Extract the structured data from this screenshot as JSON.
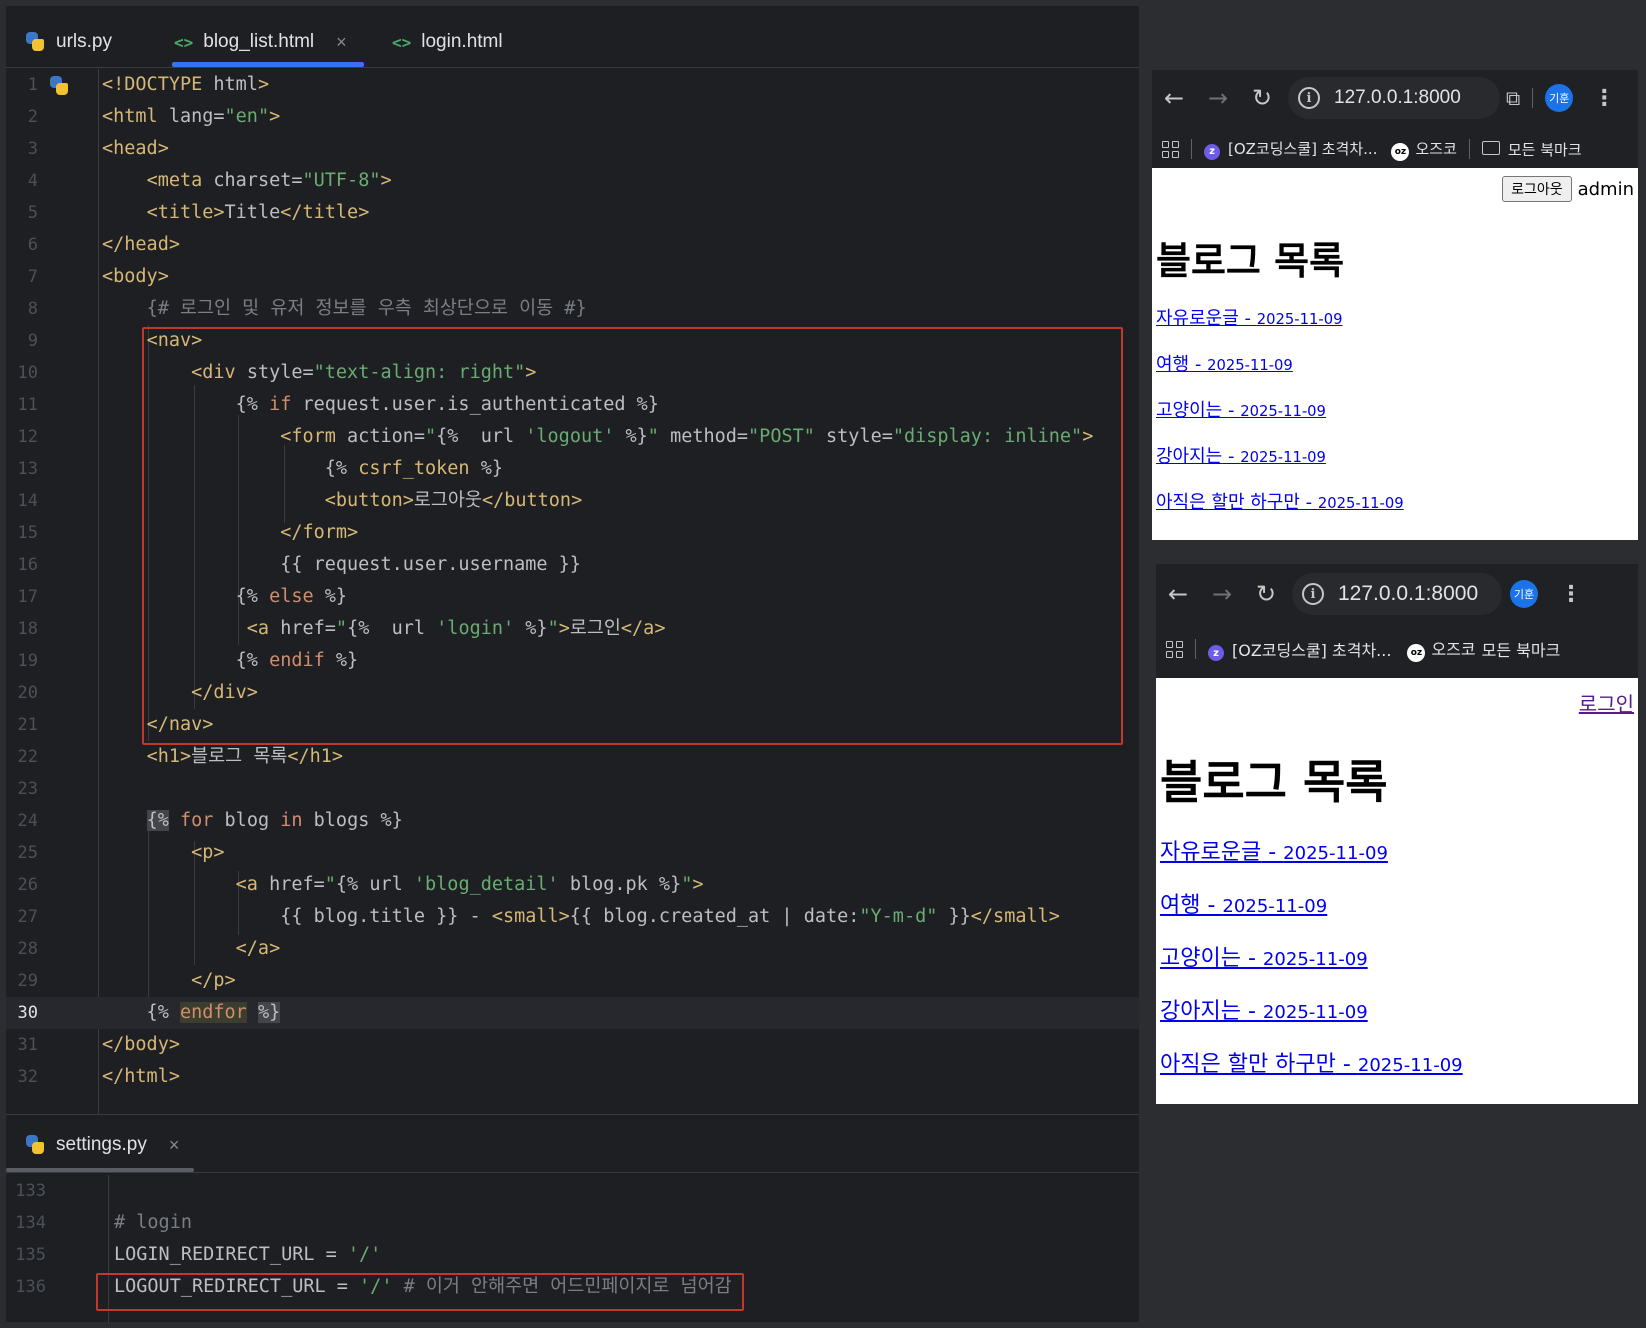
{
  "editor": {
    "tabs": [
      {
        "label": "urls.py"
      },
      {
        "label": "blog_list.html"
      },
      {
        "label": "login.html"
      }
    ],
    "close_glyph": "×",
    "current_line": "30"
  },
  "settings_pane": {
    "tab_label": "settings.py",
    "close_glyph": "×",
    "lines": [
      {
        "n": "133"
      },
      {
        "n": "134",
        "comment": "# login"
      },
      {
        "n": "135",
        "code": "LOGIN_REDIRECT_URL = ",
        "str": "'/'"
      },
      {
        "n": "136",
        "code": "LOGOUT_REDIRECT_URL = ",
        "str": "'/'",
        "comment": " # 이거 안해주면 어드민페이지로 넘어감"
      }
    ]
  },
  "browser_top": {
    "url": "127.0.0.1:8000",
    "avatar_text": "기훈",
    "bookmark_1": "[OZ코딩스쿨] 초격차...",
    "bookmark_2": "오즈코",
    "bookmark_all": "모든 북마크",
    "page": {
      "logout_button": "로그아웃",
      "username": "admin",
      "heading": "블로그 목록",
      "entries": [
        {
          "title": "자유로운글",
          "date": "2025-11-09"
        },
        {
          "title": "여행",
          "date": "2025-11-09"
        },
        {
          "title": "고양이는",
          "date": "2025-11-09"
        },
        {
          "title": "강아지는",
          "date": "2025-11-09"
        },
        {
          "title": "아직은 할만 하구만",
          "date": "2025-11-09"
        }
      ]
    }
  },
  "browser_bottom": {
    "url": "127.0.0.1:8000",
    "avatar_text": "기훈",
    "bookmark_1": "[OZ코딩스쿨] 초격차...",
    "bookmark_2": "오즈코",
    "bookmark_all": "모든 북마크",
    "page": {
      "login_link": "로그인",
      "heading": "블로그 목록",
      "entries": [
        {
          "title": "자유로운글",
          "date": "2025-11-09"
        },
        {
          "title": "여행",
          "date": "2025-11-09"
        },
        {
          "title": "고양이는",
          "date": "2025-11-09"
        },
        {
          "title": "강아지는",
          "date": "2025-11-09"
        },
        {
          "title": "아직은 할만 하구만",
          "date": "2025-11-09"
        }
      ]
    }
  },
  "colors": {
    "editor_bg": "#1e1f22",
    "tag": "#d5b778",
    "string": "#6aab73",
    "keyword": "#cf8e6d",
    "comment": "#7a7e85",
    "highlight_box": "#c0392b",
    "link": "#0000ee",
    "active_tab": "#3574f0"
  }
}
